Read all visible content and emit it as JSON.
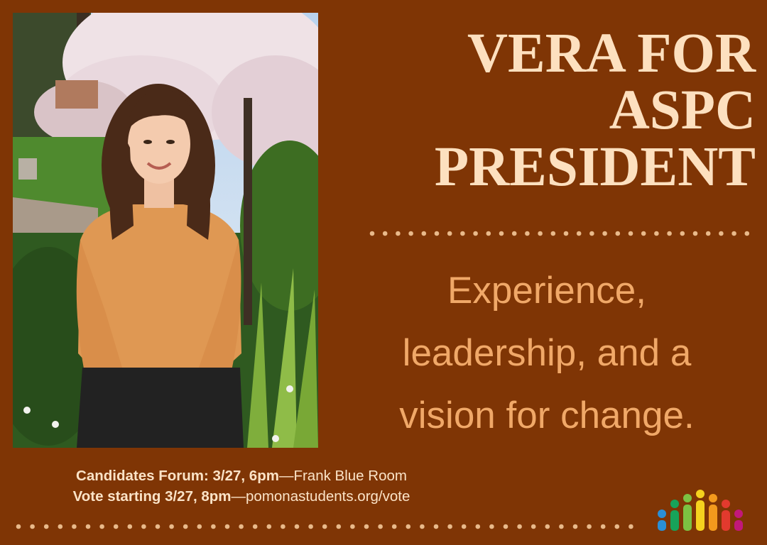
{
  "title_lines": [
    "VERA FOR",
    "ASPC",
    "PRESIDENT"
  ],
  "tagline_lines": [
    "Experience,",
    "leadership, and a",
    "vision for change."
  ],
  "details": {
    "forum_bold": "Candidates Forum: 3/27, 6pm",
    "forum_rest": "—Frank Blue Room",
    "vote_bold": "Vote starting 3/27, 8pm",
    "vote_rest": "—pomonastudents.org/vote"
  },
  "colors": {
    "background": "#7f3505",
    "title": "#fde0bf",
    "tagline": "#f0a868",
    "info": "#fbe3c7",
    "dots": "#e8b98a"
  },
  "logo_colors": [
    "#2a8fd6",
    "#17a35a",
    "#7cc242",
    "#f5d21e",
    "#f39a1d",
    "#e23a2e",
    "#c2187a"
  ],
  "photo_description_icon": "candidate-portrait"
}
